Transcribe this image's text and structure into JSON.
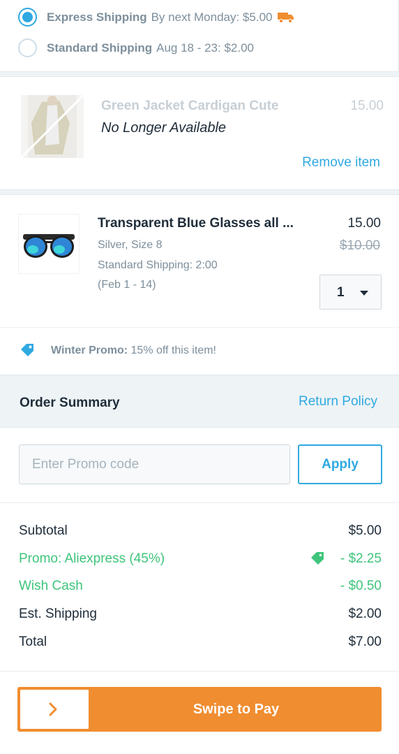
{
  "shipping": {
    "options": [
      {
        "name": "Express Shipping",
        "detail": "By next Monday: $5.00",
        "selected": true
      },
      {
        "name": "Standard Shipping",
        "detail": "Aug 18 - 23:  $2.00",
        "selected": false
      }
    ]
  },
  "items": [
    {
      "title": "Green Jacket Cardigan Cute",
      "price": "15.00",
      "status": "No Longer Available",
      "remove_label": "Remove item"
    },
    {
      "title": "Transparent Blue Glasses all ...",
      "price": "15.00",
      "old_price": "$10.00",
      "variant": "Silver, Size 8",
      "shipping": "Standard Shipping: 2:00",
      "dates": "(Feb 1 - 14)",
      "quantity": "1"
    }
  ],
  "promo_banner": {
    "name": "Winter Promo:",
    "text": "15% off this item!"
  },
  "summary": {
    "title": "Order Summary",
    "return_policy": "Return Policy",
    "promo_placeholder": "Enter Promo code",
    "apply_label": "Apply",
    "rows": [
      {
        "label": "Subtotal",
        "value": "$5.00"
      },
      {
        "label": "Promo: Aliexpress (45%)",
        "value": "- $2.25"
      },
      {
        "label": "Wish Cash",
        "value": "- $0.50"
      },
      {
        "label": "Est. Shipping",
        "value": "$2.00"
      },
      {
        "label": "Total",
        "value": "$7.00"
      }
    ]
  },
  "pay": {
    "label": "Swipe to Pay"
  },
  "colors": {
    "accent_blue": "#2fa9e0",
    "promo_green": "#3ec47b",
    "pay_orange": "#f08d30",
    "text_dark": "#1f2d3a",
    "text_muted": "#7d8f9c"
  },
  "icons": [
    "truck-icon",
    "price-tag-icon",
    "chevron-right-icon",
    "caret-down-icon"
  ]
}
